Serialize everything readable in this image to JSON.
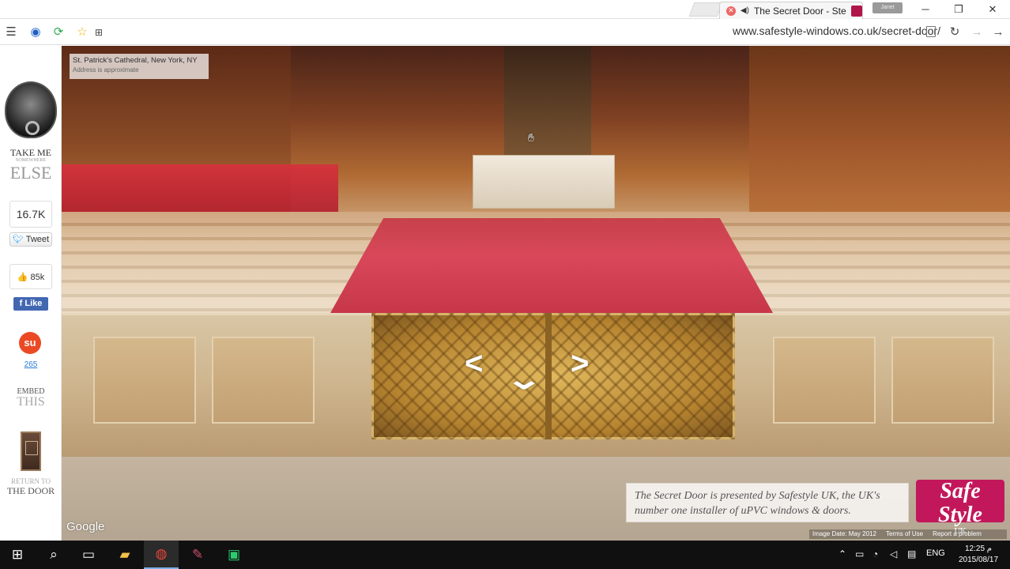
{
  "browser": {
    "tab_title": "The Secret Door - Step",
    "url": "www.safestyle-windows.co.uk/secret-door/",
    "profile_label": "Janet"
  },
  "sidebar": {
    "brand_line1": "TAKE ME",
    "brand_line2": "SOMEWHERE",
    "brand_line3": "ELSE",
    "twitter_count": "16.7K",
    "tweet_label": "Tweet",
    "fb_count": "85k",
    "fb_like_label": "Like",
    "stumble_count": "265",
    "embed_line1": "EMBED",
    "embed_line2": "THIS",
    "return_line1": "RETURN TO",
    "return_line2": "THE DOOR"
  },
  "pano": {
    "location_title": "St. Patrick's Cathedral, New York, NY",
    "location_sub": "Address is approximate",
    "google_label": "Google",
    "presented_text": "The Secret Door is presented by Safestyle UK, the UK's number one installer of uPVC windows & doors.",
    "safestyle_logo": "Safe Style",
    "safestyle_uk": "UK",
    "image_date": "Image Date: May 2012",
    "terms": "Terms of Use",
    "report": "Report a problem"
  },
  "taskbar": {
    "language": "ENG",
    "time": "12:25 م",
    "date": "2015/08/17"
  },
  "colors": {
    "accent_brand": "#c2185b",
    "facebook": "#4267b2",
    "stumbleupon": "#eb4924"
  },
  "icons": {
    "menu": "menu-icon",
    "star": "star-icon",
    "reload": "reload-icon",
    "back": "back-icon",
    "forward": "forward-icon",
    "search": "search-icon"
  }
}
